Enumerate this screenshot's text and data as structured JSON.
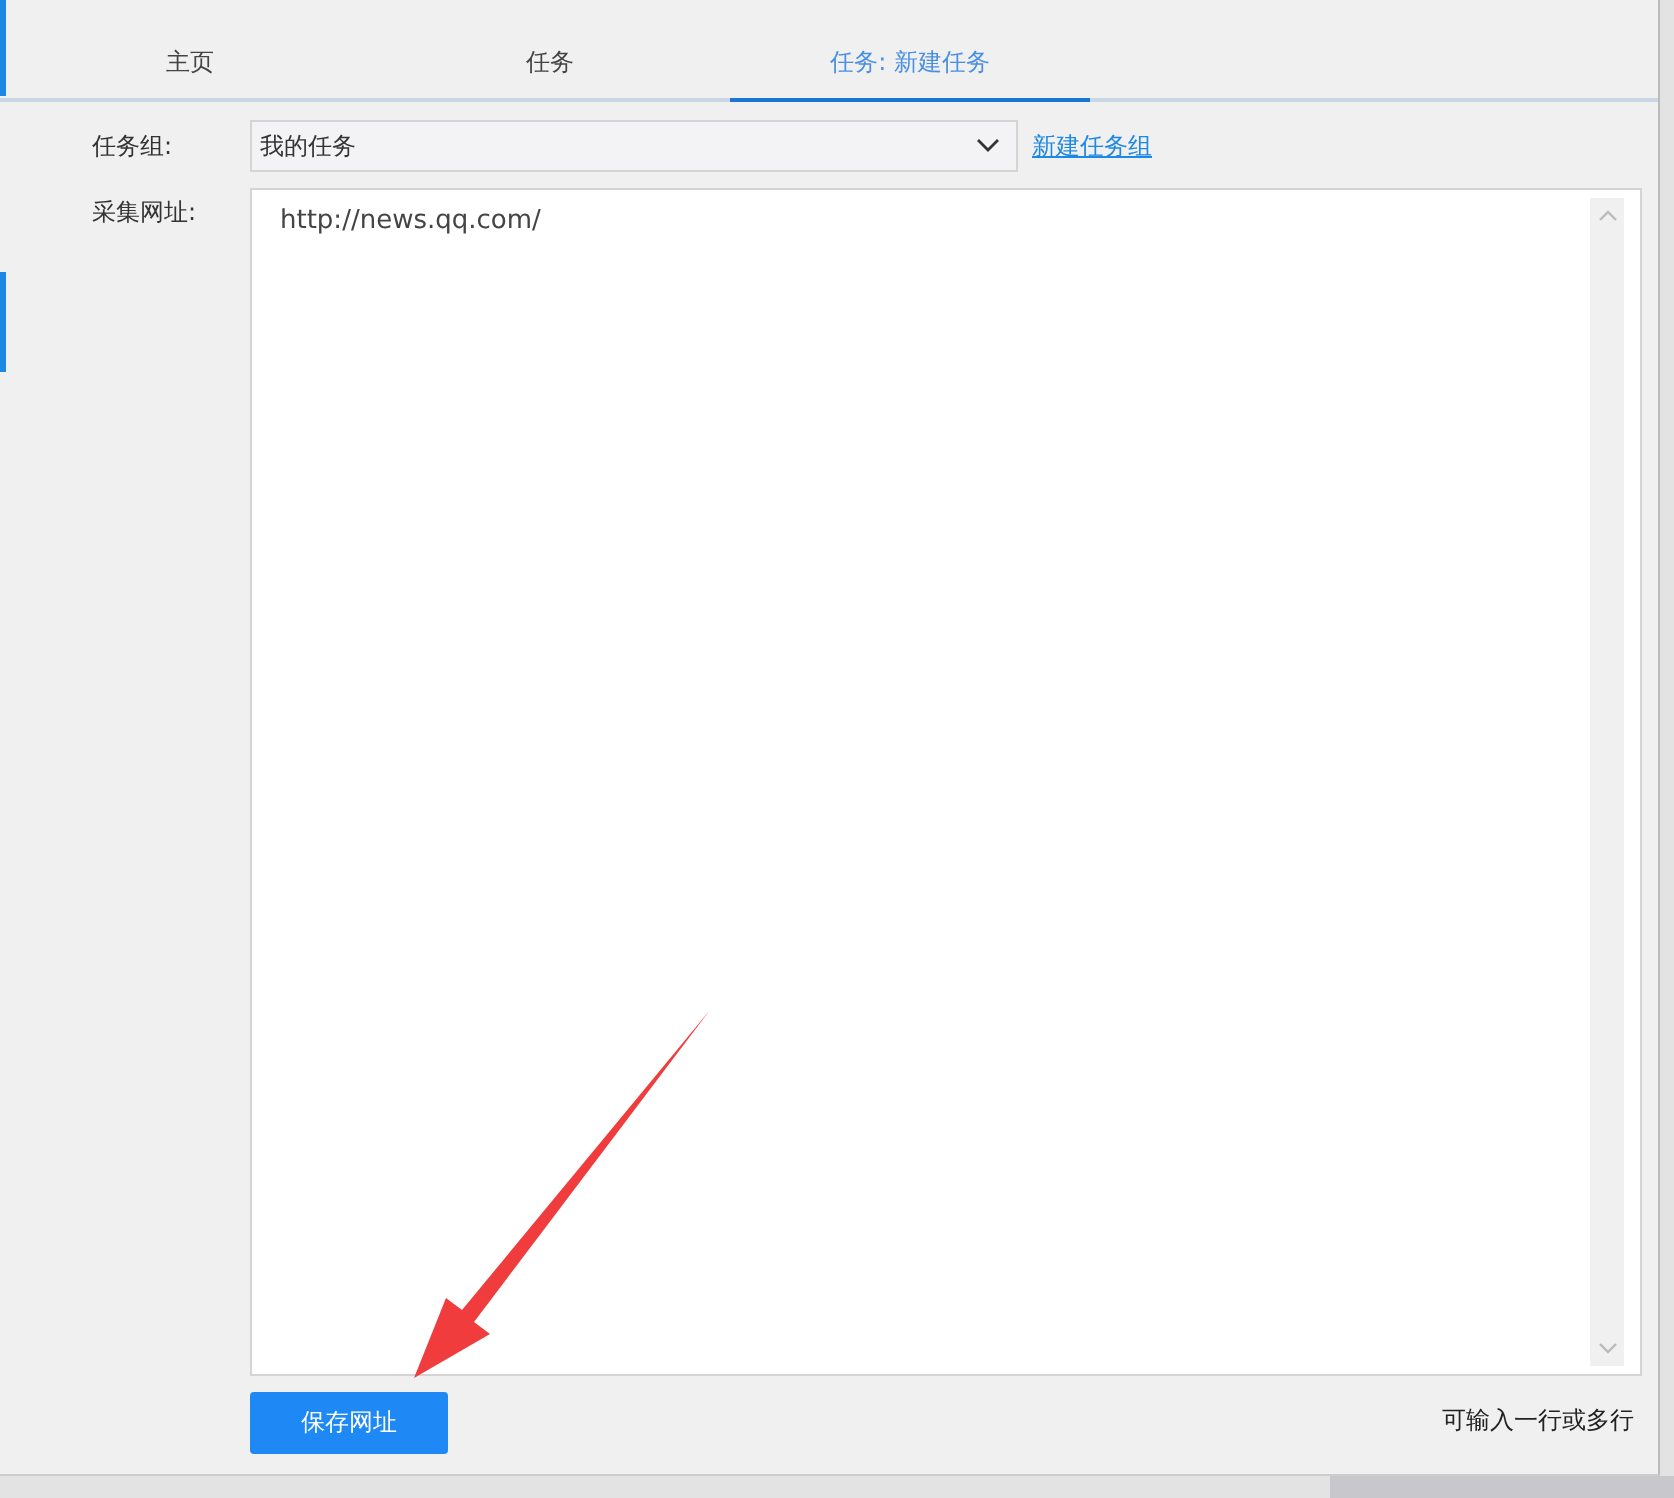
{
  "tabs": [
    {
      "label": "主页",
      "selected": false
    },
    {
      "label": "任务",
      "selected": false
    },
    {
      "label": "任务: 新建任务",
      "selected": true
    }
  ],
  "form": {
    "group_label": "任务组:",
    "group_value": "我的任务",
    "new_group_link": "新建任务组",
    "url_label": "采集网址:",
    "url_value": "http://news.qq.com/",
    "save_button": "保存网址",
    "hint": "可输入一行或多行"
  }
}
